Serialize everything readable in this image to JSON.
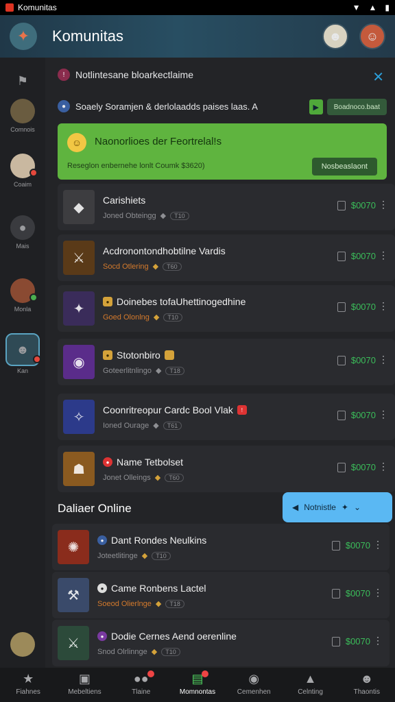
{
  "status_bar": {
    "title": "Komunitas"
  },
  "header": {
    "title": "Komunitas"
  },
  "sidebar": {
    "items": [
      {
        "label": ""
      },
      {
        "label": "Comnois"
      },
      {
        "label": "Coaim"
      },
      {
        "label": "Mais"
      },
      {
        "label": "Monla"
      },
      {
        "label": "Kan"
      },
      {
        "label": ""
      }
    ]
  },
  "notification": {
    "title": "Notlintesane bloarkectlaime",
    "message": "Soaely Soramjen & derlolaadds paises laas. A",
    "small_button": "Boadnoco.baat",
    "promo_title": "Naonorlioes der Feortrelal!s",
    "promo_sub": "Reseglon enbernehe lonlt Coumk $3620)",
    "promo_button": "Nosbeaslaont"
  },
  "cards": [
    {
      "name": "Carishiets",
      "sub": "Joned Obteingg",
      "tag": "T10",
      "price": "$0070"
    },
    {
      "name": "Acdronontondhobtilne Vardis",
      "sub": "Socd Otlering",
      "tag": "T60",
      "price": "$0070"
    },
    {
      "name": "Doinebes tofaUhettinogedhine",
      "sub": "Goed Olonlng",
      "tag": "T10",
      "price": "$0070"
    },
    {
      "name": "Stotonbiro",
      "sub": "Goteerlitnlingo",
      "tag": "T18",
      "price": "$0070"
    },
    {
      "name": "Coonritreopur   Cardc Bool Vlak",
      "sub": "Ioned Ourage",
      "tag": "T61",
      "price": "$0070"
    },
    {
      "name": "Name Tetbolset",
      "sub": "Jonet Olleings",
      "tag": "T60",
      "price": "$0070"
    }
  ],
  "section_title": "Daliaer Online",
  "float_button": "Notnistle",
  "online_cards": [
    {
      "name": "Dant Rondes Neulkins",
      "sub": "Joteetlitinge",
      "tag": "T10",
      "price": "$0070"
    },
    {
      "name": "Came Ronbens Lactel",
      "sub": "Soeod Olierlnge",
      "tag": "T18",
      "price": "$0070"
    },
    {
      "name": "Dodie Cernes Aend oerenline",
      "sub": "Snod Olrlinnge",
      "tag": "T10",
      "price": "$0070"
    }
  ],
  "bottom_tabs": [
    {
      "label": "Fiahnes",
      "icon": "star-icon"
    },
    {
      "label": "Mebeltiens",
      "icon": "chat-icon"
    },
    {
      "label": "Tlaine",
      "icon": "people-icon"
    },
    {
      "label": "Momnontas",
      "icon": "community-icon",
      "active": true
    },
    {
      "label": "Cemenhen",
      "icon": "compass-icon"
    },
    {
      "label": "Celnting",
      "icon": "bell-icon"
    },
    {
      "label": "Thaontis",
      "icon": "profile-icon"
    }
  ]
}
